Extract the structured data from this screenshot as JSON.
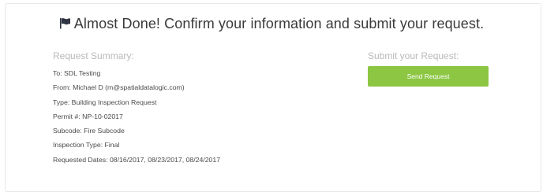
{
  "header": {
    "icon": "flag-icon",
    "title": "Almost Done! Confirm your information and submit your request."
  },
  "summary": {
    "heading": "Request Summary:",
    "lines": [
      "To: SDL Testing",
      "From: Michael D (m@spatialdatalogic.com)",
      "Type: Building Inspection Request",
      "Permit #: NP-10-02017",
      "Subcode: Fire Subcode",
      "Inspection Type: Final",
      "Requested Dates: 08/16/2017, 08/23/2017, 08/24/2017"
    ]
  },
  "submit": {
    "heading": "Submit your Request:",
    "button_label": "Send Request"
  },
  "colors": {
    "accent_button": "#8cc643",
    "heading_muted": "#b9b9b9",
    "text": "#4a4a4a"
  }
}
